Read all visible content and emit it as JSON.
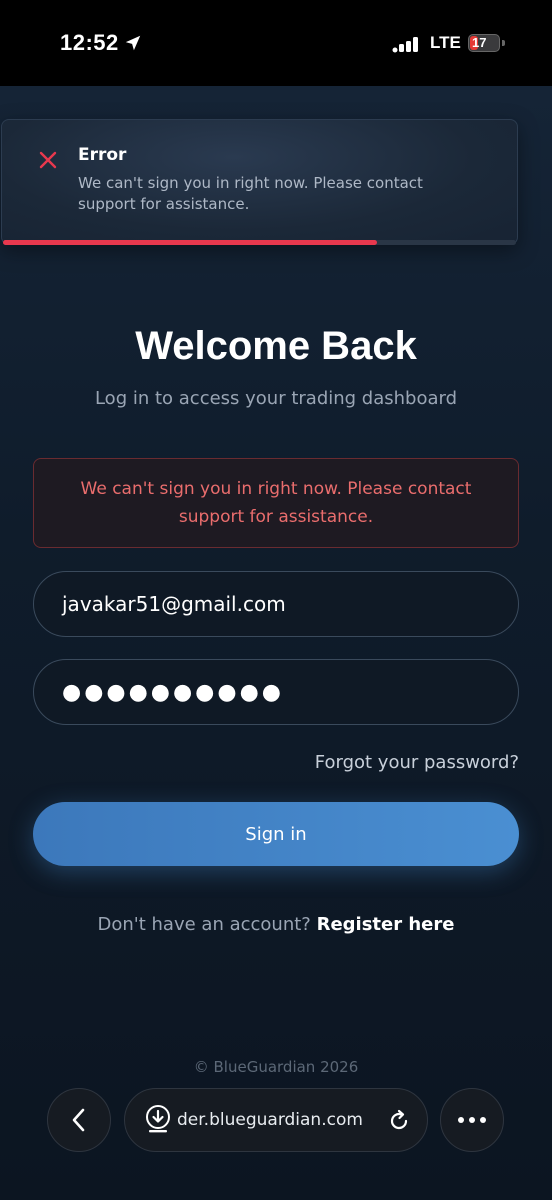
{
  "status_bar": {
    "time": "12:52",
    "network": "LTE",
    "battery": "17",
    "icons": [
      "location-arrow-icon",
      "signal-icon",
      "battery-charging-icon"
    ]
  },
  "toast": {
    "title": "Error",
    "message": "We can't sign you in right now. Please contact support for assistance.",
    "progress_fraction": 0.73,
    "accent_color": "#e8384e",
    "icon": "close-icon"
  },
  "login": {
    "title": "Welcome Back",
    "subtitle": "Log in to access your trading dashboard",
    "error_message": "We can't sign you in right now. Please contact support for assistance.",
    "email_value": "javakar51@gmail.com",
    "password_value": "●●●●●●●●●●",
    "forgot_label": "Forgot your password?",
    "signin_label": "Sign in",
    "register_prompt": "Don't have an account?",
    "register_link": "Register here",
    "accent_color": "#4a8fd2"
  },
  "footer": {
    "copyright": "© BlueGuardian 2026"
  },
  "browser": {
    "url": "der.blueguardian.com",
    "icons": [
      "back-chevron-icon",
      "download-icon",
      "reload-icon",
      "more-icon"
    ]
  }
}
